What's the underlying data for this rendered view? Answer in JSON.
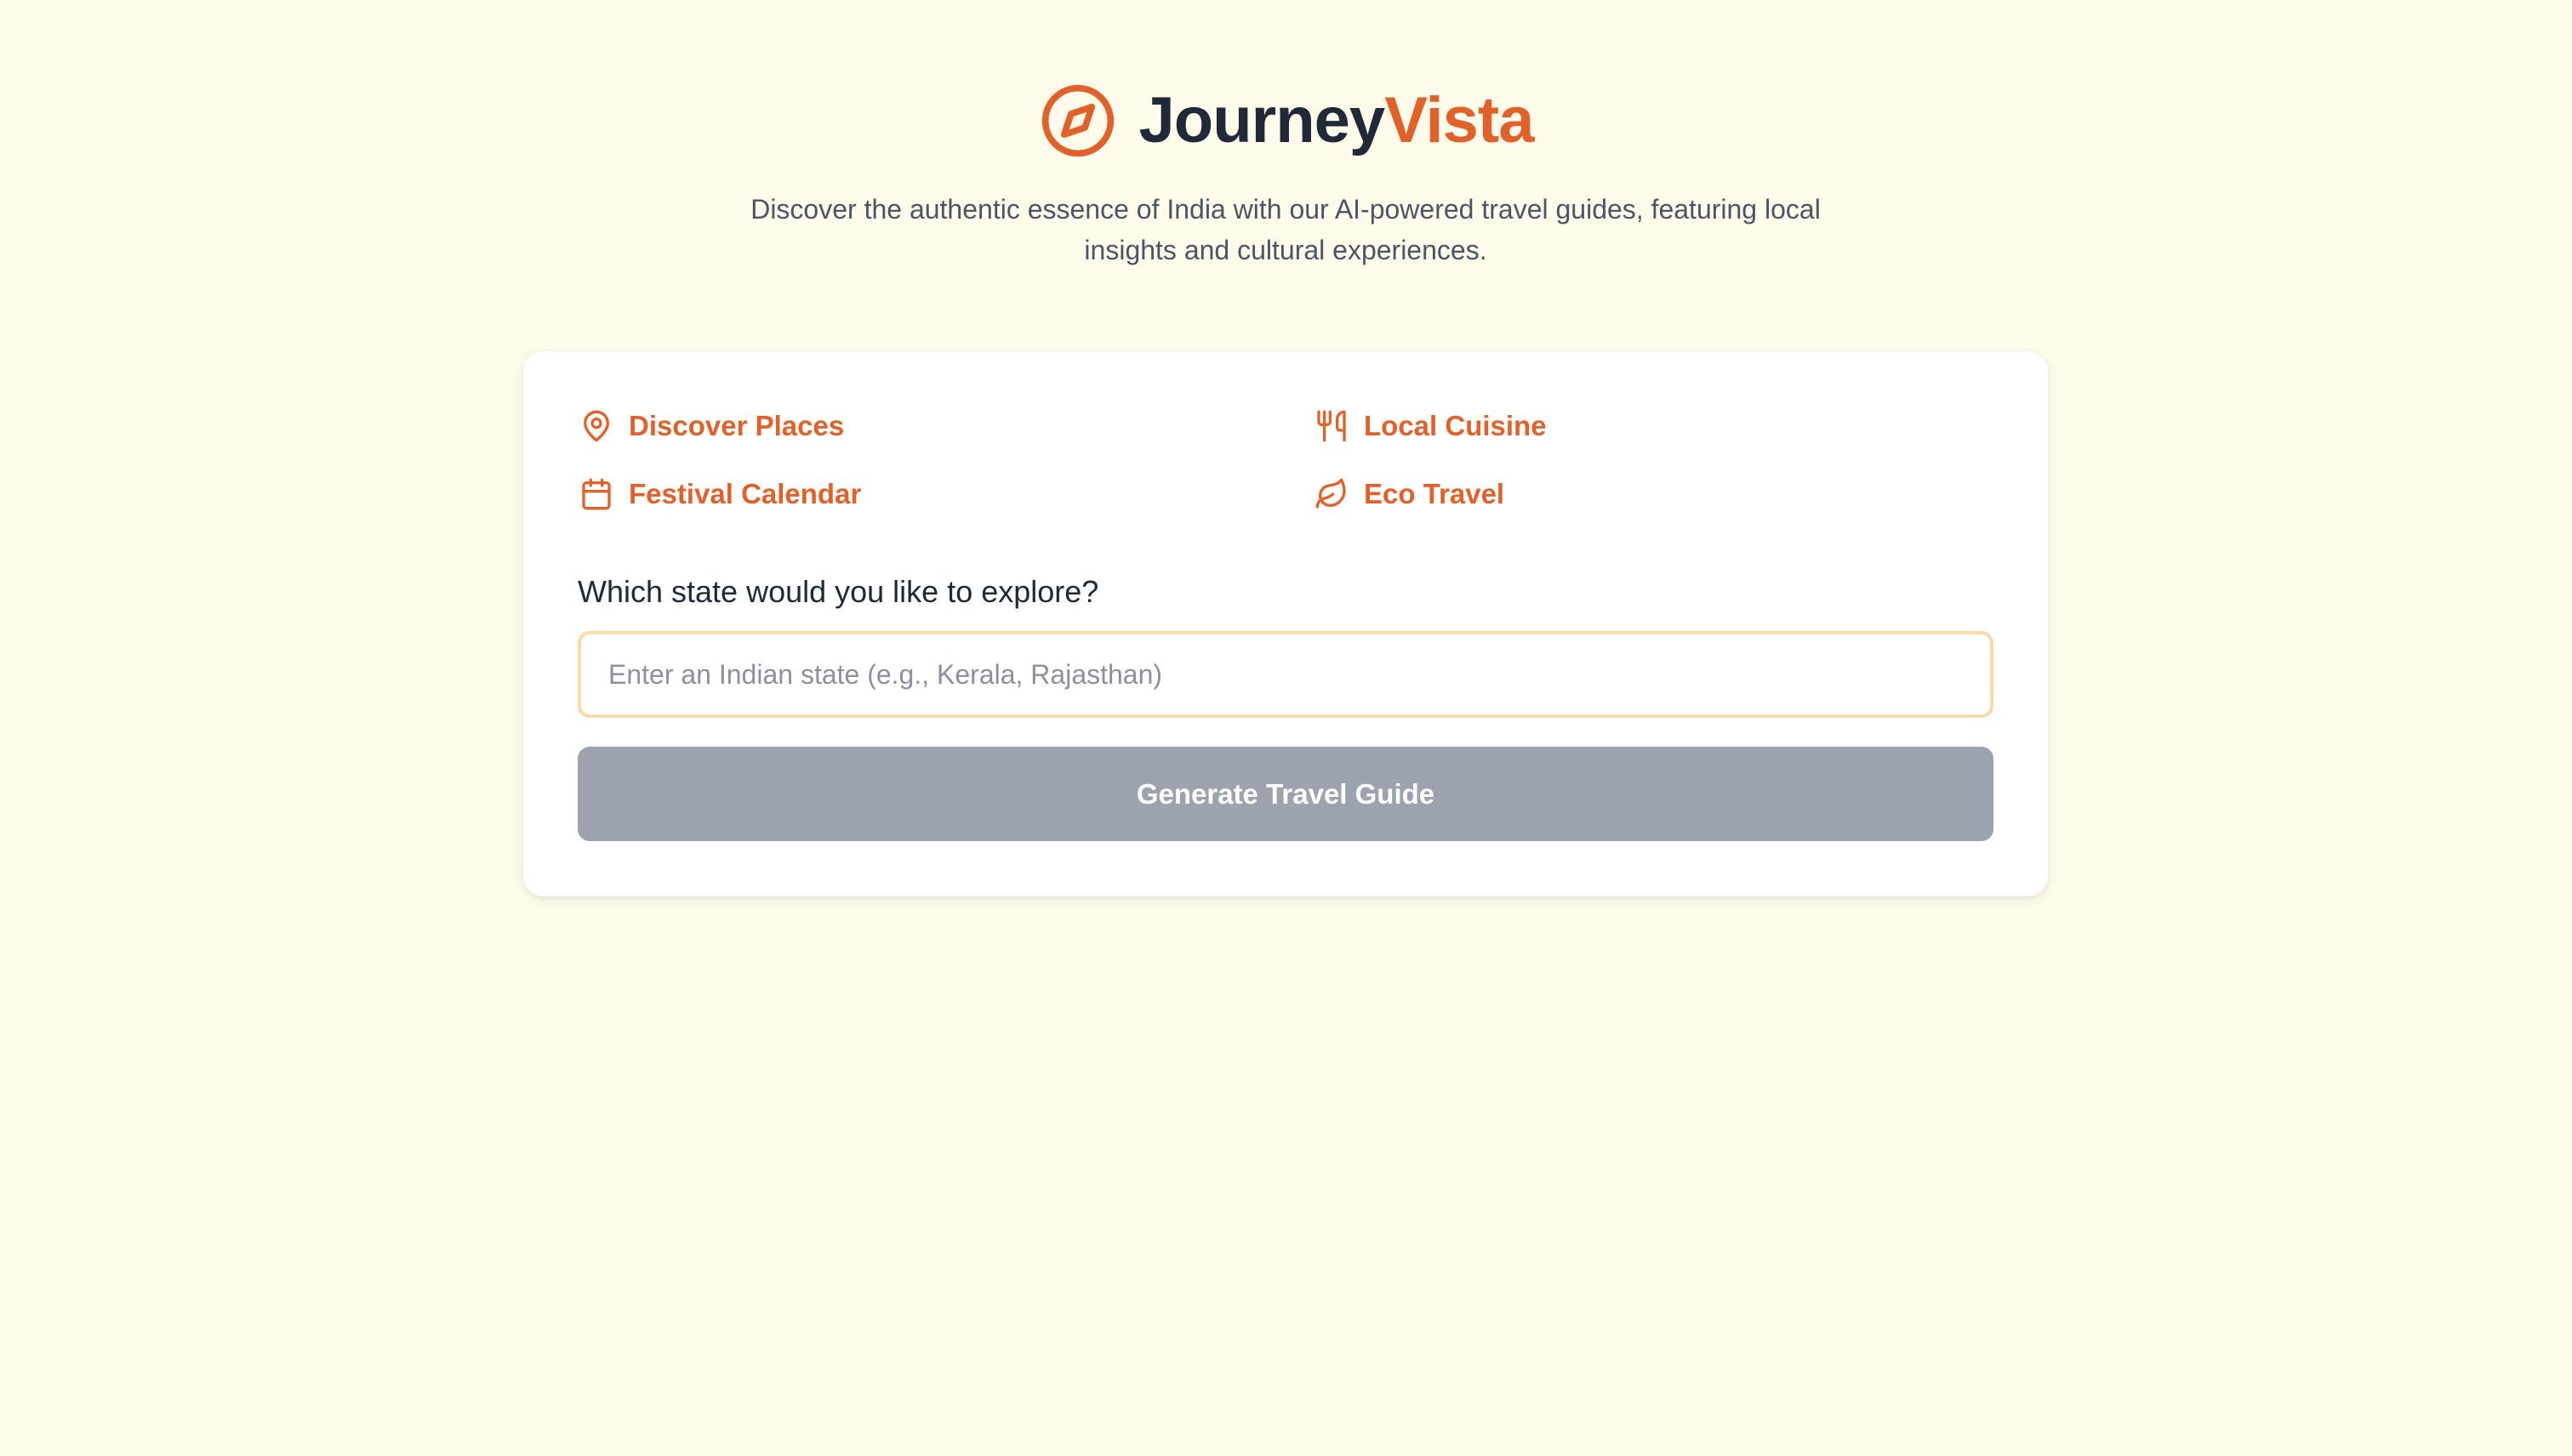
{
  "brand": {
    "name_part1": "Journey",
    "name_part2": "Vista",
    "icon": "compass-icon",
    "accent_color": "#e0622a"
  },
  "tagline": "Discover the authentic essence of India with our AI-powered travel guides, featuring local insights and cultural experiences.",
  "features": [
    {
      "label": "Discover Places",
      "icon": "map-pin-icon"
    },
    {
      "label": "Local Cuisine",
      "icon": "utensils-icon"
    },
    {
      "label": "Festival Calendar",
      "icon": "calendar-icon"
    },
    {
      "label": "Eco Travel",
      "icon": "leaf-icon"
    }
  ],
  "form": {
    "question": "Which state would you like to explore?",
    "input_value": "",
    "input_placeholder": "Enter an Indian state (e.g., Kerala, Rajasthan)",
    "button_label": "Generate Travel Guide",
    "button_color": "#9ca3af"
  }
}
